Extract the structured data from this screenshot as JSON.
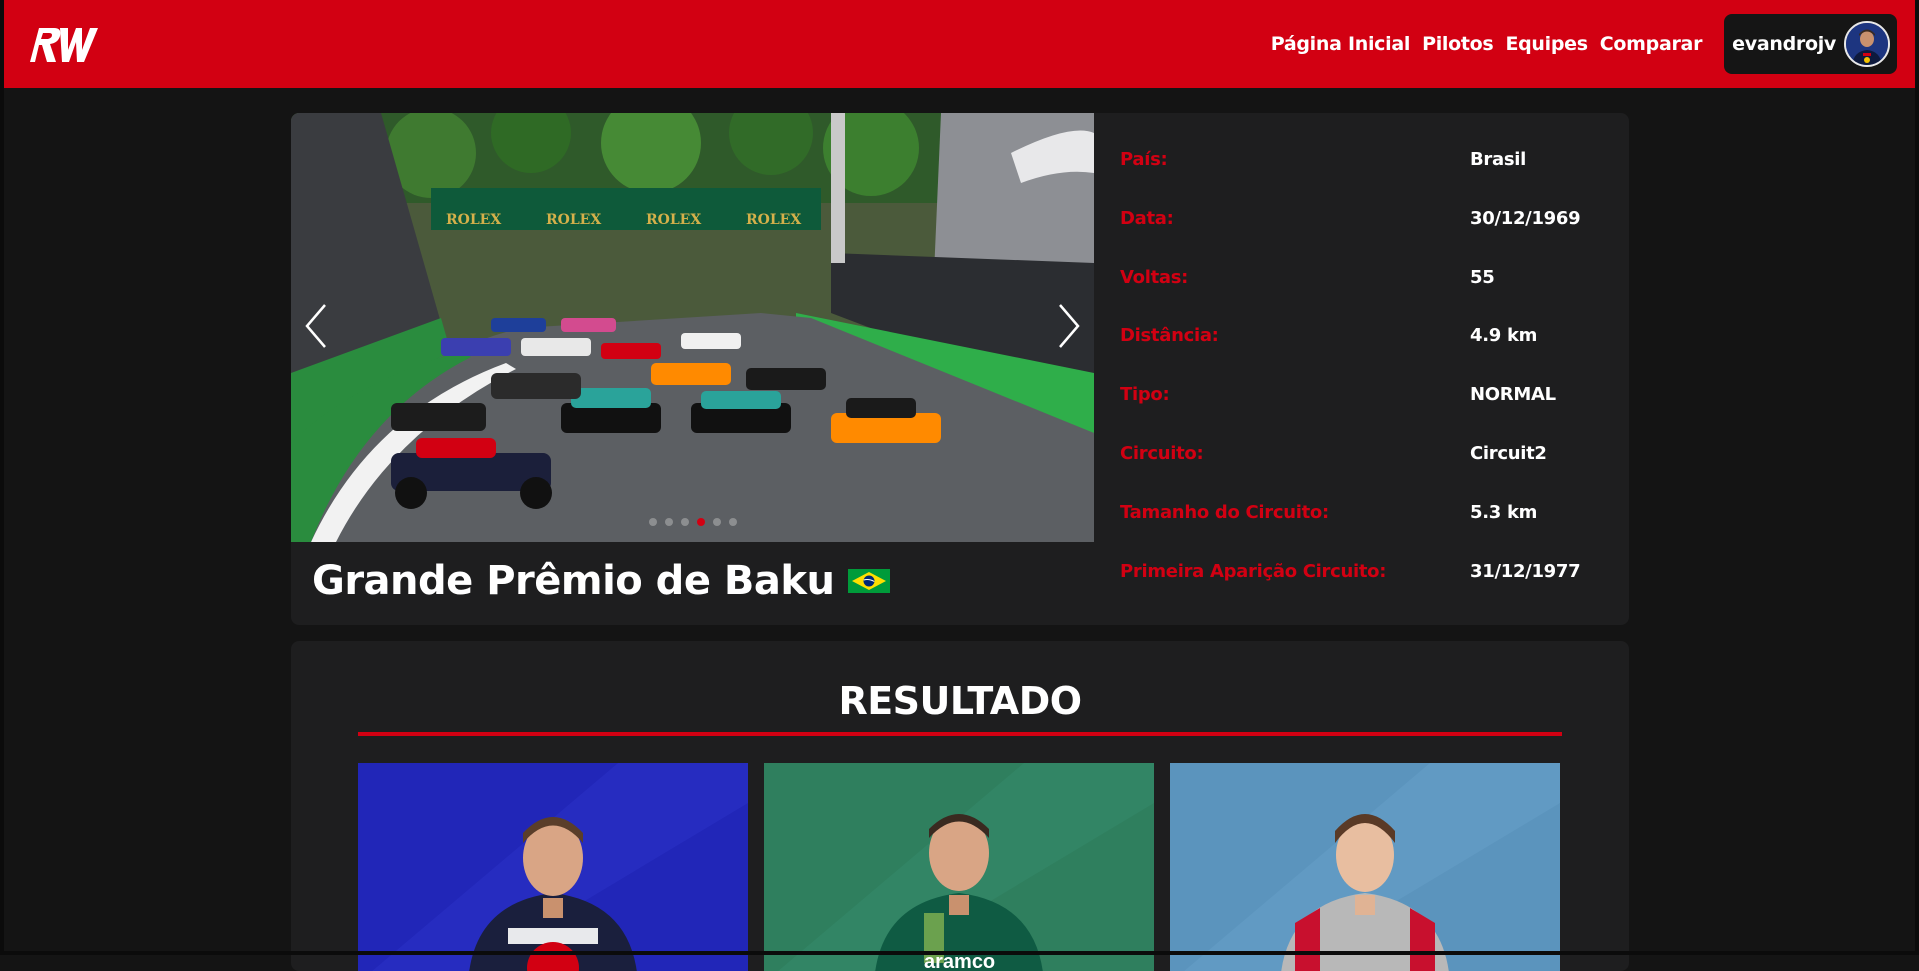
{
  "navbar": {
    "logo_text": "RW",
    "links": [
      "Página Inicial",
      "Pilotos",
      "Equipes",
      "Comparar"
    ],
    "username": "evandrojv"
  },
  "race": {
    "name": "Grande Prêmio de Baku",
    "flag": "brazil-flag-icon",
    "carousel": {
      "slides": 6,
      "active_index": 3
    },
    "info": [
      {
        "label": "País:",
        "value": "Brasil"
      },
      {
        "label": "Data:",
        "value": "30/12/1969"
      },
      {
        "label": "Voltas:",
        "value": "55"
      },
      {
        "label": "Distância:",
        "value": "4.9 km"
      },
      {
        "label": "Tipo:",
        "value": "NORMAL"
      },
      {
        "label": "Circuito:",
        "value": "Circuit2"
      },
      {
        "label": "Tamanho do Circuito:",
        "value": "5.3 km"
      },
      {
        "label": "Primeira Aparição Circuito:",
        "value": "31/12/1977"
      }
    ]
  },
  "result": {
    "title": "RESULTADO",
    "cards": [
      {
        "bg": "#2126b8",
        "suit": "#1a1f3d",
        "accent": "#d20012"
      },
      {
        "bg": "#2f7f5e",
        "suit": "#0f5b43",
        "accent": "#c8e85a"
      },
      {
        "bg": "#5b94bd",
        "suit": "#b8b8b8",
        "accent": "#c8102e"
      }
    ]
  },
  "colors": {
    "brand": "#d20012",
    "panel": "#1e1e1f",
    "background": "#141414"
  }
}
